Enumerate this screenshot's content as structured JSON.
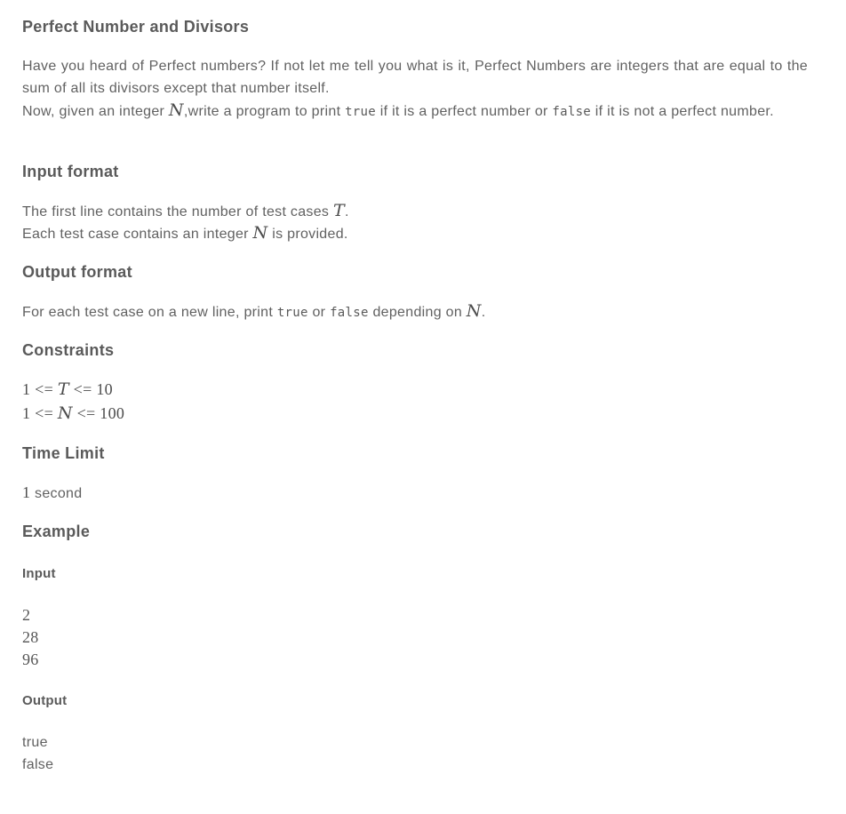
{
  "title": "Perfect Number and Divisors",
  "description": {
    "line1": "Have you heard of Perfect numbers? If not let me tell you what is it, Perfect Numbers are integers that are equal to the sum of all its divisors except that number itself.",
    "line2_pre": "Now, given an integer ",
    "line2_var": "N",
    "line2_mid": ",write a program to print ",
    "code_true": "true",
    "line2_mid2": " if it is a perfect number or ",
    "code_false": "false",
    "line2_post": " if it is not a perfect number."
  },
  "input_format": {
    "heading": "Input format",
    "line1_pre": "The first line contains the number of test cases ",
    "line1_var": "T",
    "line1_post": ".",
    "line2_pre": "Each test case contains an integer ",
    "line2_var": "N",
    "line2_post": " is provided."
  },
  "output_format": {
    "heading": "Output format",
    "pre": "For each test case on a new line, print ",
    "code_true": "true",
    "mid": " or ",
    "code_false": "false",
    "mid2": " depending on ",
    "var": "N",
    "post": "."
  },
  "constraints": {
    "heading": "Constraints",
    "c1_lo": "1",
    "c1_op1": " <= ",
    "c1_var": "T",
    "c1_op2": " <= ",
    "c1_hi": "10",
    "c2_lo": "1",
    "c2_op1": " <= ",
    "c2_var": "N",
    "c2_op2": " <= ",
    "c2_hi": "100"
  },
  "time_limit": {
    "heading": "Time Limit",
    "value_num": "1",
    "value_unit": " second"
  },
  "example": {
    "heading": "Example",
    "input_heading": "Input",
    "input_lines": [
      "2",
      "28",
      "96"
    ],
    "output_heading": "Output",
    "output_lines": [
      "true",
      "false"
    ]
  },
  "colors": {
    "text": "#616161",
    "heading": "#5a5a5a",
    "background": "#ffffff"
  }
}
